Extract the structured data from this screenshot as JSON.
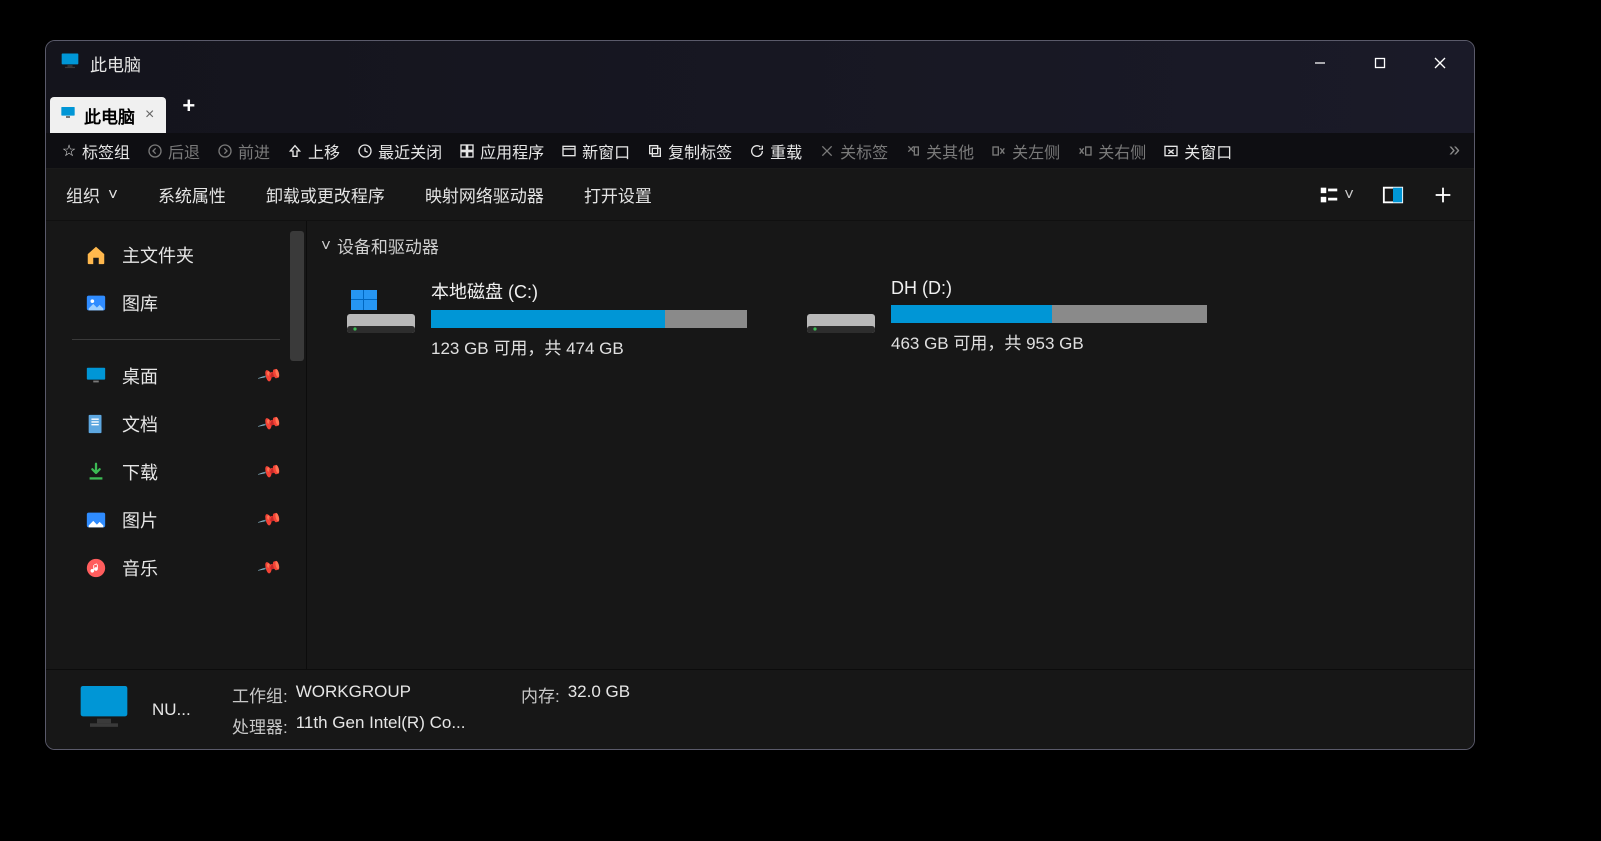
{
  "title": "此电脑",
  "tab": {
    "label": "此电脑"
  },
  "toolbar": {
    "bookmarks": "标签组",
    "back": "后退",
    "forward": "前进",
    "up": "上移",
    "recent": "最近关闭",
    "apps": "应用程序",
    "newwin": "新窗口",
    "duptab": "复制标签",
    "reload": "重载",
    "closetab": "关标签",
    "closeother": "关其他",
    "closeleft": "关左侧",
    "closeright": "关右侧",
    "closewin": "关窗口"
  },
  "commandbar": {
    "organize": "组织",
    "sysprops": "系统属性",
    "uninstall": "卸载或更改程序",
    "mapdrive": "映射网络驱动器",
    "opensettings": "打开设置"
  },
  "sidebar": {
    "home": "主文件夹",
    "gallery": "图库",
    "desktop": "桌面",
    "documents": "文档",
    "downloads": "下载",
    "pictures": "图片",
    "music": "音乐"
  },
  "section": "设备和驱动器",
  "drives": [
    {
      "name": "本地磁盘 (C:)",
      "status": "123 GB 可用，共 474 GB",
      "fill": 74,
      "os": true
    },
    {
      "name": "DH (D:)",
      "status": "463 GB 可用，共 953 GB",
      "fill": 51,
      "os": false
    }
  ],
  "status": {
    "name": "NU...",
    "workgroup_label": "工作组:",
    "workgroup": "WORKGROUP",
    "mem_label": "内存:",
    "mem": "32.0 GB",
    "cpu_label": "处理器:",
    "cpu": "11th Gen Intel(R) Co..."
  }
}
